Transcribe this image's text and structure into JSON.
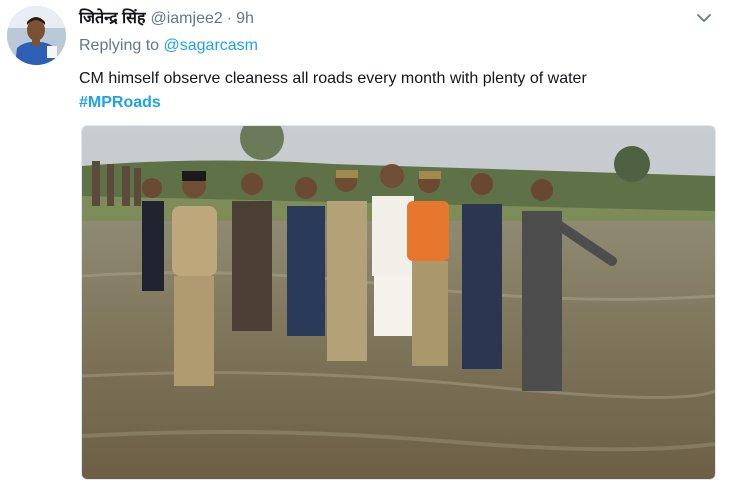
{
  "tweet": {
    "author_name": "जितेन्द्र सिंह",
    "handle": "@iamjee2",
    "separator": "·",
    "time": "9h",
    "reply_prefix": "Replying to",
    "reply_to": "@sagarcasm",
    "text": "CM himself observe cleaness all roads every month with plenty of water",
    "hashtag": "#MPRoads"
  },
  "icons": {
    "menu": "chevron-down-icon"
  },
  "colors": {
    "link": "#1da1f2",
    "secondary_text": "#657786",
    "primary_text": "#14171a"
  }
}
